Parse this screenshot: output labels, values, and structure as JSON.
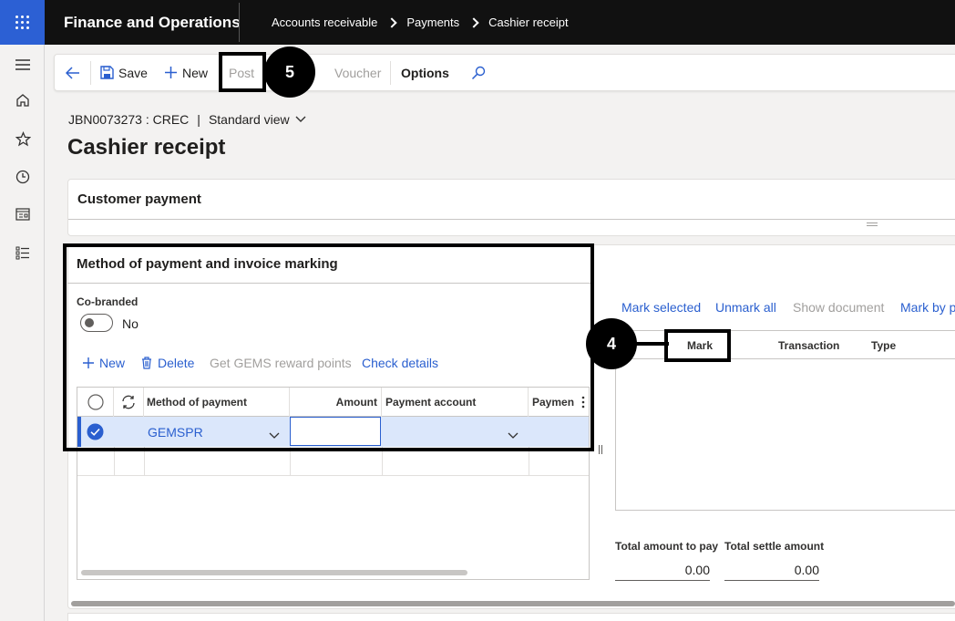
{
  "app": {
    "title": "Finance and Operations"
  },
  "breadcrumbs": [
    "Accounts receivable",
    "Payments",
    "Cashier receipt"
  ],
  "nav_icons": [
    "hamburger-icon",
    "home-icon",
    "star-icon",
    "clock-icon",
    "workspace-icon",
    "list-icon"
  ],
  "actionpane": {
    "save_label": "Save",
    "new_label": "New",
    "post_label": "Post",
    "voucher_label": "Voucher",
    "options_label": "Options"
  },
  "callouts": {
    "post_number": "5",
    "mark_number": "4"
  },
  "header": {
    "record_id": "JBN0073273 : CREC",
    "separator": "|",
    "view_label": "Standard view",
    "page_title": "Cashier receipt"
  },
  "customer_payment": {
    "title": "Customer payment"
  },
  "payment_section": {
    "title": "Method of payment and invoice marking",
    "cobranded_label": "Co-branded",
    "cobranded_value": "No",
    "cobranded_on": false,
    "actions": {
      "new": "New",
      "delete": "Delete",
      "gems": "Get GEMS reward points",
      "check": "Check details"
    },
    "columns": {
      "method": "Method of payment",
      "amount": "Amount",
      "account": "Payment account",
      "payment": "Paymen"
    },
    "rows": [
      {
        "method": "GEMSPR",
        "amount": "",
        "account": ""
      }
    ]
  },
  "marking": {
    "actions": {
      "mark_selected": "Mark selected",
      "unmark_all": "Unmark all",
      "show_document": "Show document",
      "mark_by": "Mark by p"
    },
    "columns": {
      "mark": "Mark",
      "transaction": "Transaction",
      "type": "Type"
    },
    "totals": {
      "pay_label": "Total amount to pay",
      "pay_value": "0.00",
      "settle_label": "Total settle amount",
      "settle_value": "0.00"
    }
  },
  "colors": {
    "brand": "#2c60d4",
    "link": "#2a5fcf",
    "topbar": "#111111",
    "selected_row": "#dbe7fb"
  }
}
